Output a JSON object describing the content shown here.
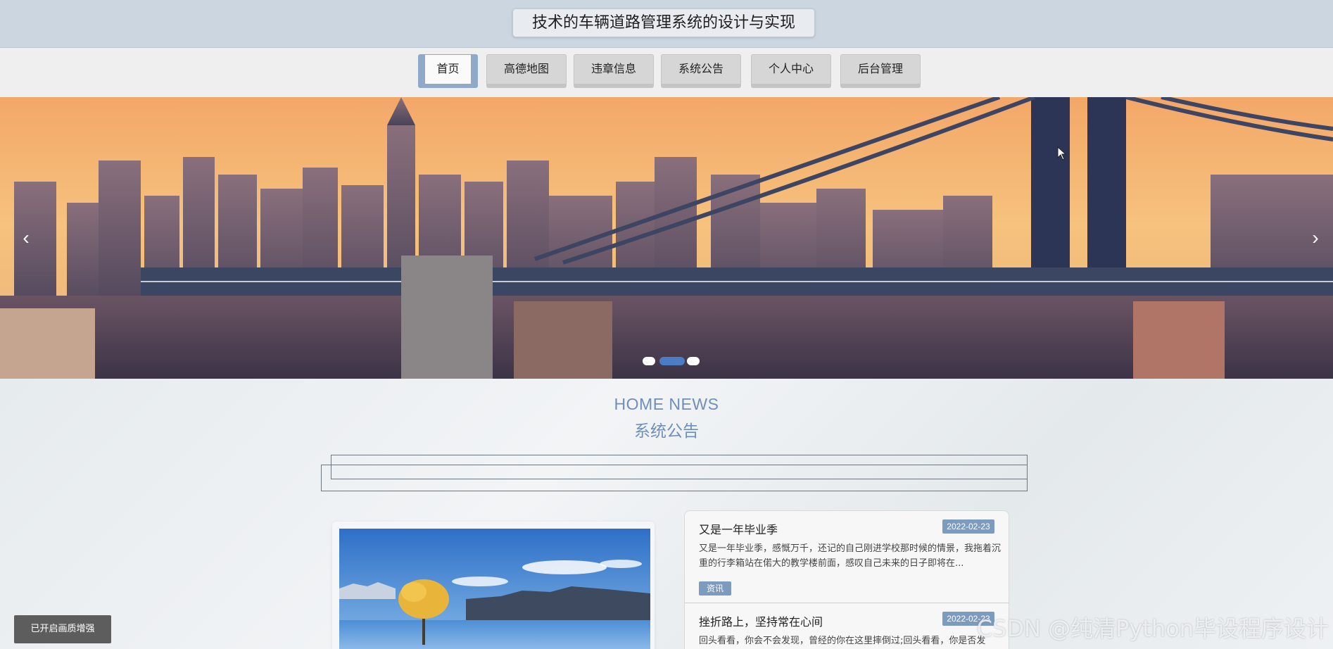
{
  "header": {
    "title": "技术的车辆道路管理系统的设计与实现"
  },
  "nav": {
    "items": [
      {
        "label": "首页",
        "active": true
      },
      {
        "label": "高德地图",
        "active": false
      },
      {
        "label": "违章信息",
        "active": false
      },
      {
        "label": "系统公告",
        "active": false
      },
      {
        "label": "个人中心",
        "active": false
      },
      {
        "label": "后台管理",
        "active": false
      }
    ]
  },
  "carousel": {
    "prev_icon": "chevron-left-icon",
    "next_icon": "chevron-right-icon",
    "prev_glyph": "‹",
    "next_glyph": "›",
    "slide_count": 3,
    "active_slide": 2
  },
  "section": {
    "en_title": "HOME NEWS",
    "title": "系统公告"
  },
  "news": [
    {
      "title": "又是一年毕业季",
      "date": "2022-02-23",
      "desc": "又是一年毕业季，感慨万千，还记的自己刚进学校那时候的情景，我拖着沉重的行李箱站在偌大的教学楼前面，感叹自己未来的日子即将在...",
      "tag": "资讯"
    },
    {
      "title": "挫折路上，坚持常在心间",
      "date": "2022-02-23",
      "desc": "回头看看，你会不会发现，曾经的你在这里摔倒过;回头看看，你是否发",
      "tag": ""
    }
  ],
  "footer": {
    "enhance_label": "已开启画质增强",
    "watermark": "CSDN @纯清Python毕设程序设计"
  },
  "colors": {
    "accent": "#7d9abf",
    "header_bg": "#ccd6e0",
    "nav_bg": "#efefef"
  }
}
